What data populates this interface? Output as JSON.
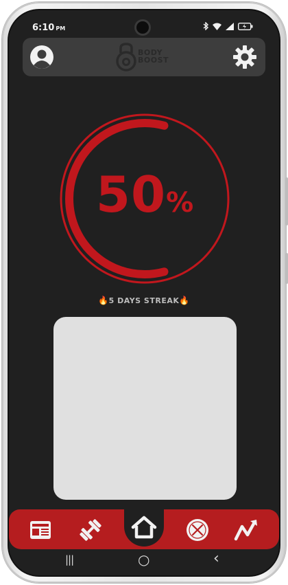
{
  "status_bar": {
    "time": "6:10",
    "time_suffix": "PM"
  },
  "header": {
    "logo_line1": "BODY",
    "logo_line2": "BOOST"
  },
  "progress": {
    "number": "50",
    "sign": "%",
    "fraction": 0.5
  },
  "streak": {
    "text": "5 DAYS STREAK",
    "flame": "🔥"
  },
  "nav": {
    "items": [
      {
        "name": "news",
        "icon": "newspaper-icon"
      },
      {
        "name": "workout",
        "icon": "dumbbell-icon"
      },
      {
        "name": "home",
        "icon": "home-icon",
        "active": true
      },
      {
        "name": "nutrition",
        "icon": "food-plate-icon"
      },
      {
        "name": "progress",
        "icon": "trend-up-icon"
      }
    ]
  },
  "system_nav": {
    "recents": "|||",
    "home": "○",
    "back": "‹"
  },
  "colors": {
    "accent": "#c1171d",
    "navbar": "#b51d1f",
    "background": "#202020",
    "header": "#3d3d3d"
  }
}
